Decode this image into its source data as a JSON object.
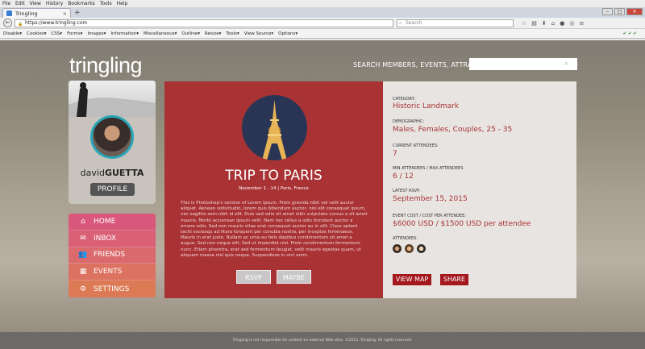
{
  "browser": {
    "menus": [
      "File",
      "Edit",
      "View",
      "History",
      "Bookmarks",
      "Tools",
      "Help"
    ],
    "tab_title": "Tringling",
    "tab_close": "×",
    "new_tab": "+",
    "url": "https://www.tringling.com",
    "search_placeholder": "Search",
    "bookmarks": [
      "Disable▾",
      "Cookies▾",
      "CSS▾",
      "Forms▾",
      "Images▾",
      "Information▾",
      "Miscellaneous▾",
      "Outline▾",
      "Resize▾",
      "Tools▾",
      "View Source▾",
      "Options▾"
    ],
    "bookmarks_right": "✔ ✔ ✔"
  },
  "header": {
    "logo": "tringling",
    "search_label": "SEARCH MEMBERS, EVENTS, ATTRACTIONS:",
    "search_value": ""
  },
  "profile": {
    "first": "david",
    "last": "GUETTA",
    "button": "PROFILE"
  },
  "nav": [
    {
      "label": "HOME",
      "icon": "home-icon",
      "color": "#d9577a"
    },
    {
      "label": "INBOX",
      "icon": "mail-icon",
      "color": "#d9617a"
    },
    {
      "label": "FRIENDS",
      "icon": "friends-icon",
      "color": "#d96a6e"
    },
    {
      "label": "EVENTS",
      "icon": "calendar-icon",
      "color": "#d97260"
    },
    {
      "label": "SETTINGS",
      "icon": "gear-icon",
      "color": "#d97a55"
    }
  ],
  "event": {
    "title": "TRIP TO PARIS",
    "subtitle": "November 1 - 14 | Paris, France",
    "description": "This is Photoshop's version of Lorem Ipsum. Proin gravida nibh vel velit auctor aliquet. Aenean sollicitudin, lorem quis bibendum auctor, nisi elit consequat ipsum, nec sagittis sem nibh id elit. Duis sed odio sit amet nibh vulputate cursus a sit amet mauris. Morbi accumsan ipsum velit. Nam nec tellus a odio tincidunt auctor a ornare odio. Sed non mauris vitae erat consequat auctor eu in elit. Class aptent taciti sociosqu ad litora torquent per conubia nostra, per inceptos himenaeos. Mauris in erat justo. Nullam ac urna eu felis dapibus condimentum sit amet a augue. Sed non neque elit. Sed ut imperdiet nisi. Proin condimentum fermentum nunc. Etiam pharetra, erat sed fermentum feugiat, velit mauris egestas quam, ut aliquam massa nisl quis neque. Suspendisse in orci enim.",
    "rsvp": "RSVP",
    "maybe": "MAYBE"
  },
  "info": {
    "category_label": "CATEGORY:",
    "category": "Historic Landmark",
    "demographic_label": "DEMOGRAPHIC:",
    "demographic": "Males, Females, Couples, 25 - 35",
    "current_label": "CURRENT ATTENDEES:",
    "current": "7",
    "minmax_label": "MIN ATTENDEES / MAX ATTENDEES:",
    "minmax": "6 / 12",
    "rsvp_label": "LATEST RSVP:",
    "rsvp_date": "September 15, 2015",
    "cost_label": "EVENT COST / COST PER ATTENDEE:",
    "cost": "$6000 USD / $1500 USD per attendee",
    "attendees_label": "ATTENDEES:",
    "view_map": "VIEW MAP",
    "share": "SHARE"
  },
  "footer": "Tringling is not responsible for content on external Web sites. ©2015, Tringling. All rights reserved."
}
